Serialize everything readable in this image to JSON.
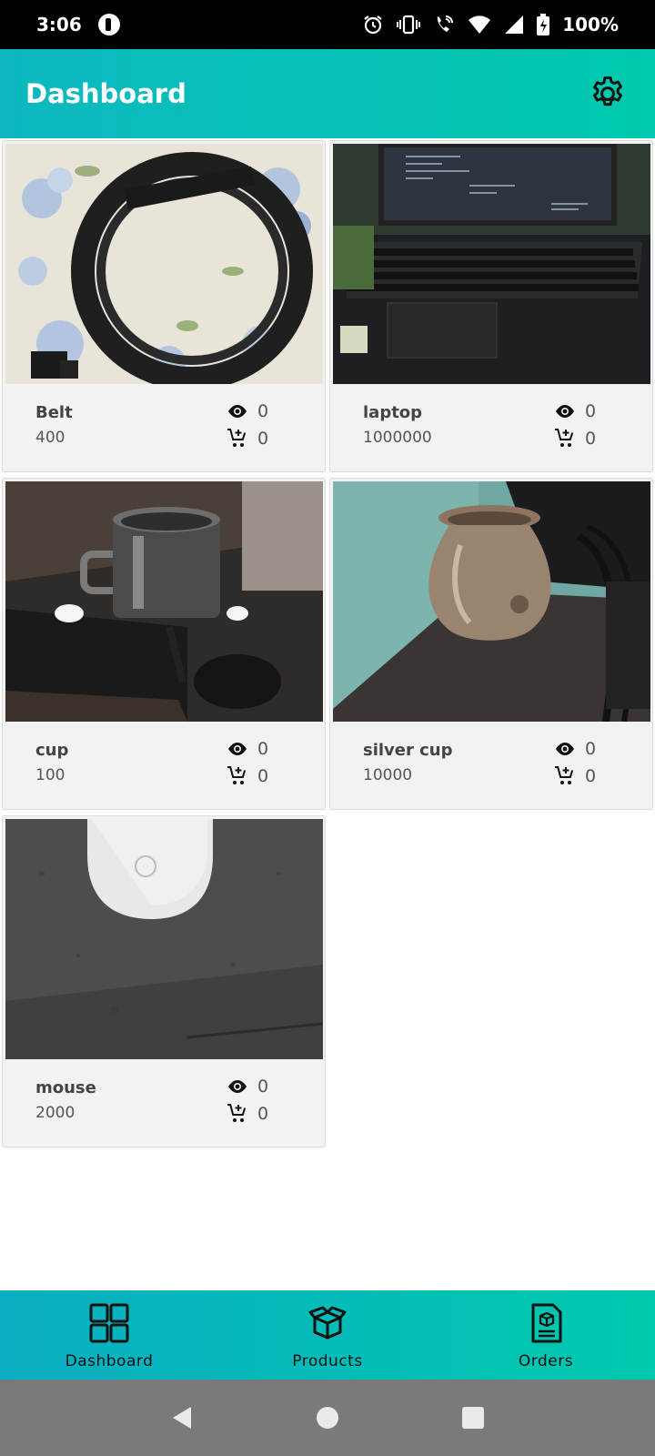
{
  "status_bar": {
    "time": "3:06",
    "battery": "100%",
    "icons": [
      "alarm-icon",
      "vibrate-icon",
      "wifi-call-icon",
      "wifi-icon",
      "signal-icon",
      "battery-icon"
    ]
  },
  "app_bar": {
    "title": "Dashboard",
    "settings_icon": "gear-icon"
  },
  "products": [
    {
      "name": "Belt",
      "price": "400",
      "views": "0",
      "cart": "0",
      "image": "belt"
    },
    {
      "name": "laptop",
      "price": "1000000",
      "views": "0",
      "cart": "0",
      "image": "laptop"
    },
    {
      "name": "cup",
      "price": "100",
      "views": "0",
      "cart": "0",
      "image": "cup"
    },
    {
      "name": "silver cup",
      "price": "10000",
      "views": "0",
      "cart": "0",
      "image": "silver-cup"
    },
    {
      "name": "mouse",
      "price": "2000",
      "views": "0",
      "cart": "0",
      "image": "mouse"
    }
  ],
  "bottom_nav": {
    "items": [
      {
        "label": "Dashboard",
        "icon": "dashboard-grid-icon"
      },
      {
        "label": "Products",
        "icon": "box-icon"
      },
      {
        "label": "Orders",
        "icon": "order-document-icon"
      }
    ]
  },
  "colors": {
    "accent_start": "#0db8c0",
    "accent_end": "#00c9ae",
    "card_bg": "#f2f2f2"
  }
}
